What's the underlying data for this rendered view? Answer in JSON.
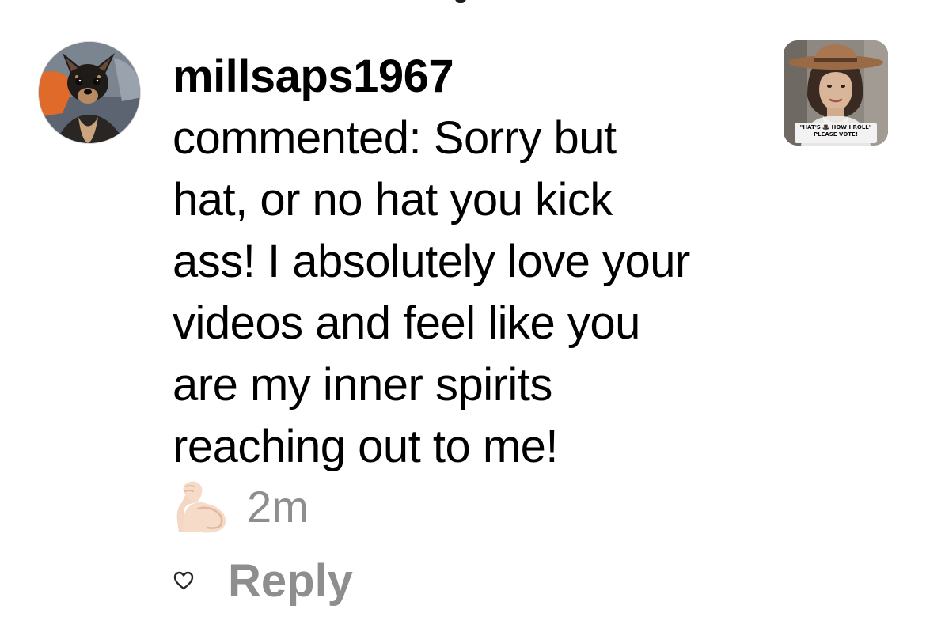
{
  "notification": {
    "username": "millsaps1967",
    "comment_lines": [
      "commented: Sorry but",
      "hat, or no hat you kick",
      "ass! I absolutely love your",
      "videos and feel like you",
      "are my inner spirits",
      "reaching out to me!"
    ],
    "reaction_icon": "flexed-biceps-icon",
    "timestamp": "2m",
    "reply_label": "Reply",
    "like_icon": "heart-outline-icon",
    "avatar_icon": "dog-avatar",
    "thumbnail": {
      "caption_line1": "\"HAT'S 🎩 HOW I ROLL\"",
      "caption_line2": "PLEASE VOTE!"
    }
  },
  "colors": {
    "text": "#000000",
    "secondary_text": "#8e8e8e",
    "background": "#ffffff"
  }
}
